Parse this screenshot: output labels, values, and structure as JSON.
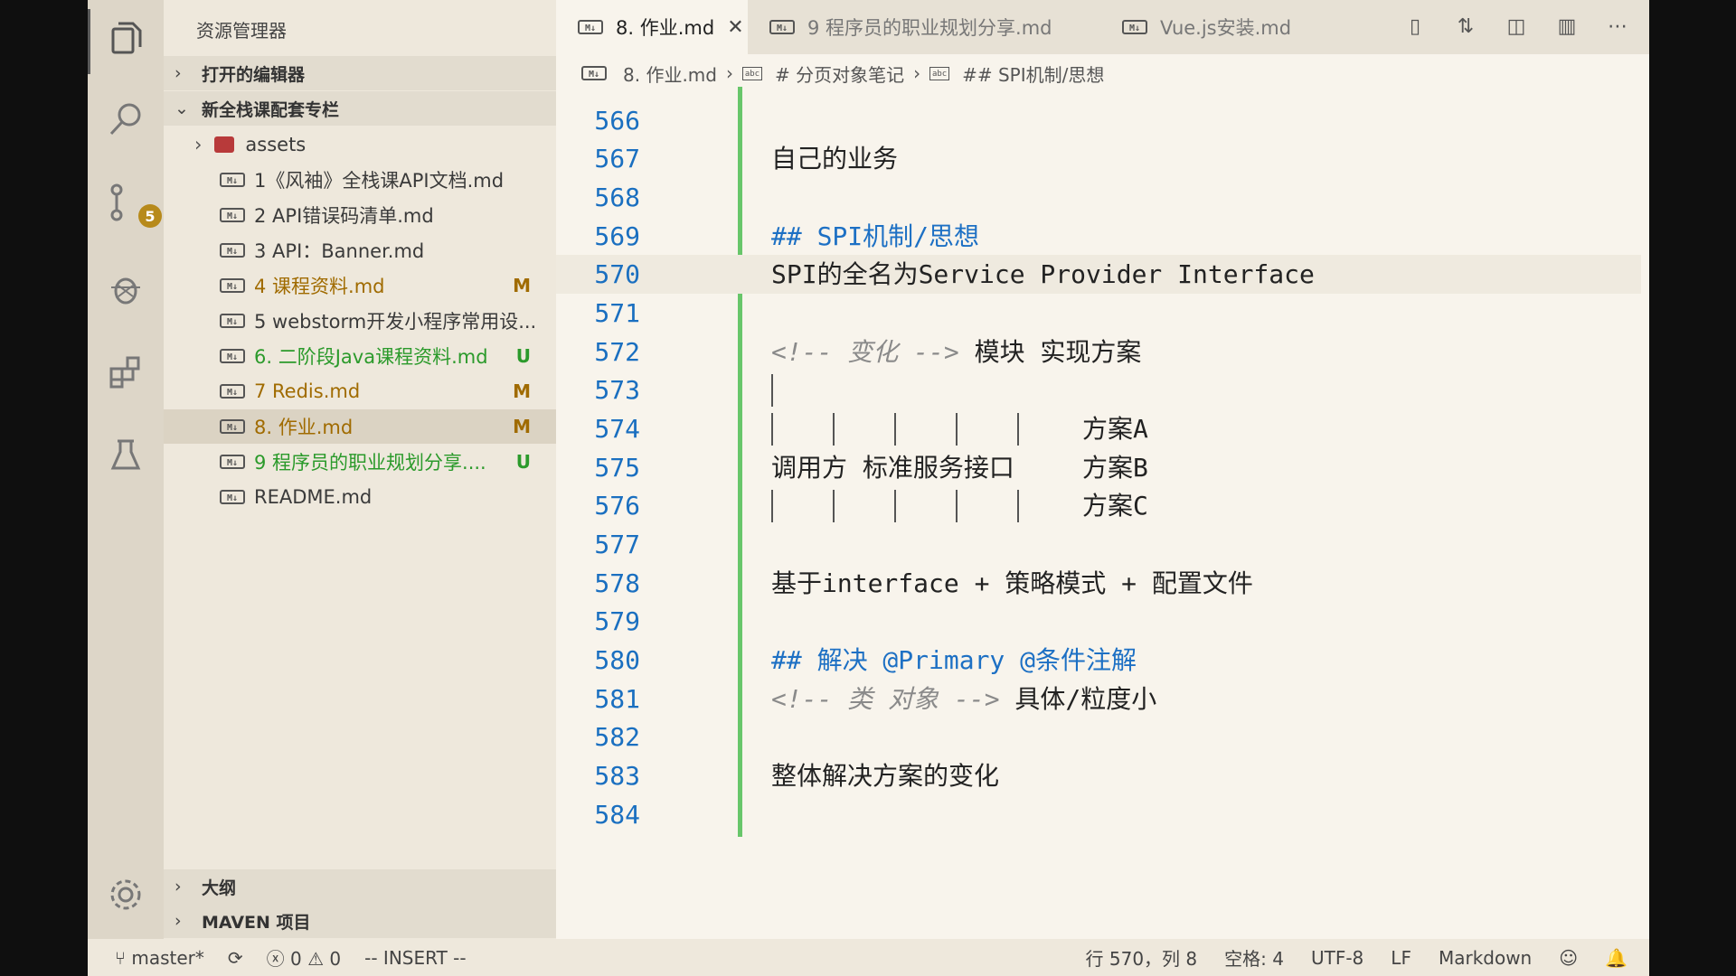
{
  "sidebar": {
    "title": "资源管理器",
    "open_editors": "打开的编辑器",
    "project": "新全栈课配套专栏",
    "items": [
      {
        "name": "assets",
        "kind": "folder",
        "status": ""
      },
      {
        "name": "1《风袖》全栈课API文档.md",
        "kind": "md",
        "status": ""
      },
      {
        "name": "2 API错误码清单.md",
        "kind": "md",
        "status": ""
      },
      {
        "name": "3 API：Banner.md",
        "kind": "md",
        "status": ""
      },
      {
        "name": "4 课程资料.md",
        "kind": "md",
        "status": "M"
      },
      {
        "name": "5 webstorm开发小程序常用设...",
        "kind": "md",
        "status": ""
      },
      {
        "name": "6. 二阶段Java课程资料.md",
        "kind": "md",
        "status": "U"
      },
      {
        "name": "7 Redis.md",
        "kind": "md",
        "status": "M"
      },
      {
        "name": "8. 作业.md",
        "kind": "md",
        "status": "M"
      },
      {
        "name": "9 程序员的职业规划分享....",
        "kind": "md",
        "status": "U"
      },
      {
        "name": "README.md",
        "kind": "md",
        "status": ""
      }
    ],
    "outline": "大纲",
    "maven": "MAVEN 项目"
  },
  "scm_badge": "5",
  "tabs": [
    {
      "label": "8. 作业.md",
      "active": true
    },
    {
      "label": "9 程序员的职业规划分享.md",
      "active": false
    },
    {
      "label": "Vue.js安装.md",
      "active": false
    }
  ],
  "md_icon_text": "M↓",
  "abc_icon_text": "abc",
  "breadcrumb": [
    "8. 作业.md",
    "# 分页对象笔记",
    "## SPI机制/思想"
  ],
  "editor": {
    "lines": [
      {
        "n": "566",
        "text": ""
      },
      {
        "n": "567",
        "text": "自己的业务"
      },
      {
        "n": "568",
        "text": ""
      },
      {
        "n": "569",
        "text": "## SPI机制/思想"
      },
      {
        "n": "570",
        "text": "SPI的全名为Service Provider Interface"
      },
      {
        "n": "571",
        "text": ""
      },
      {
        "n": "572",
        "c": "<!-- 变化 -->",
        "t": " 模块 实现方案"
      },
      {
        "n": "573",
        "text": ""
      },
      {
        "n": "574",
        "text": "方案A"
      },
      {
        "n": "575",
        "text": "调用方 标准服务接口",
        "t2": "方案B"
      },
      {
        "n": "576",
        "text": "方案C"
      },
      {
        "n": "577",
        "text": ""
      },
      {
        "n": "578",
        "text": "基于interface + 策略模式 + 配置文件"
      },
      {
        "n": "579",
        "text": ""
      },
      {
        "n": "580",
        "text": "## 解决 @Primary @条件注解"
      },
      {
        "n": "581",
        "c": "<!-- 类 对象 -->",
        "t": " 具体/粒度小"
      },
      {
        "n": "582",
        "text": ""
      },
      {
        "n": "583",
        "text": "整体解决方案的变化"
      },
      {
        "n": "584",
        "text": ""
      }
    ]
  },
  "status": {
    "branch": "master*",
    "errors": "0",
    "warnings": "0",
    "mode": "-- INSERT --",
    "position": "行 570，列 8",
    "spaces": "空格: 4",
    "encoding": "UTF-8",
    "eol": "LF",
    "language": "Markdown"
  }
}
